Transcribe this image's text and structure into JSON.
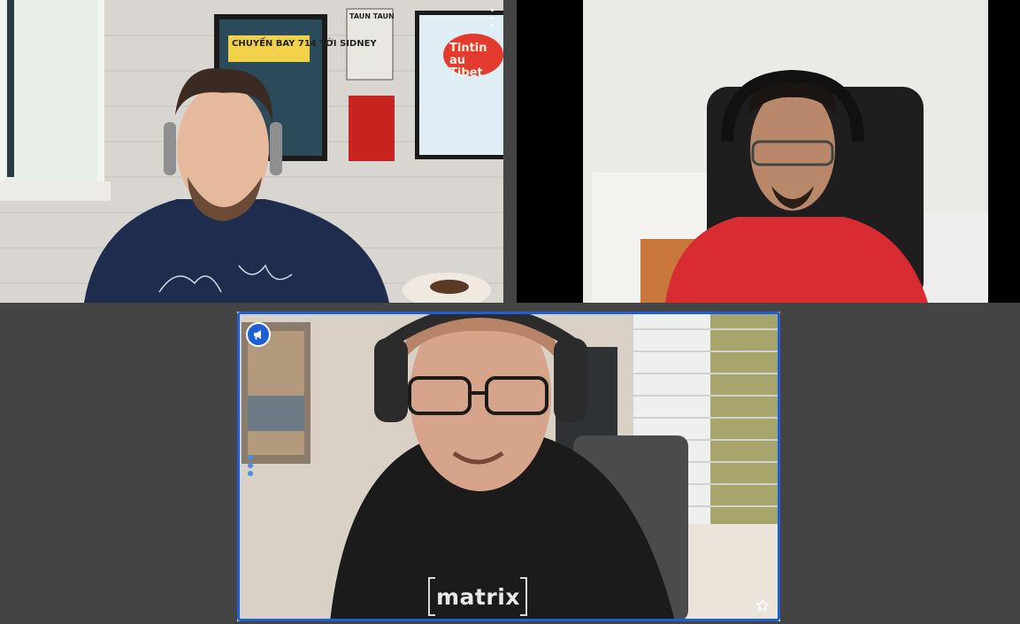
{
  "participants": [
    {
      "poster_left": "CHUYẾN BAY 714 TỚI SIDNEY",
      "poster_small": "TAUN TAUN",
      "poster_right": "Tintin au Tibet"
    },
    {},
    {
      "shirt_text": "matrix"
    }
  ],
  "colors": {
    "background": "#444444",
    "active_speaker_border": "#1f5fd6"
  },
  "icons": {
    "tile_menu": "kebab-menu-icon",
    "speaker_badge": "megaphone-icon",
    "favourite": "star-icon"
  }
}
